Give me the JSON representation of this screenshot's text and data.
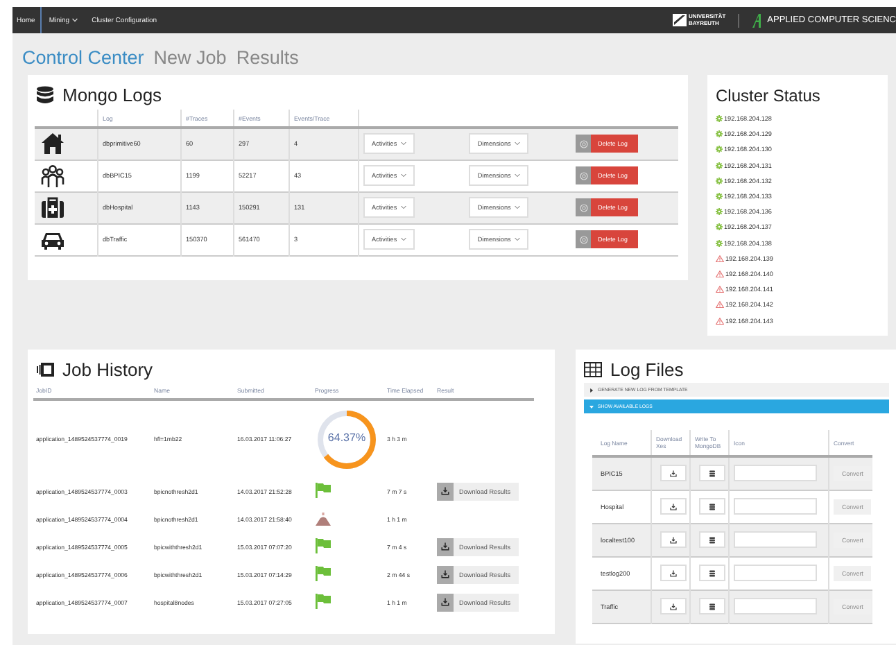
{
  "nav": {
    "items": [
      {
        "label": "Home",
        "dropdown": false
      },
      {
        "label": "Mining",
        "dropdown": true
      },
      {
        "label": "Cluster Configuration",
        "dropdown": false
      }
    ],
    "university_logo": {
      "line_1": "UNIVERSITÄT",
      "line_2": "BAYREUTH"
    },
    "department_logo": "APPLIED COMPUTER SCIENC"
  },
  "tabs": [
    {
      "label": "Control Center",
      "selected": true
    },
    {
      "label": "New Job",
      "selected": false
    },
    {
      "label": "Results",
      "selected": false
    }
  ],
  "mongo_logs": {
    "title": "Mongo Logs",
    "columns": [
      "Log",
      "#Traces",
      "#Events",
      "Events/Trace"
    ],
    "rows": [
      {
        "log": "dbprimitive60",
        "traces": "60",
        "events": "297",
        "events_per_trace": "4",
        "activities": "Activities",
        "dimensions": "Dimensions",
        "delete": "Delete Log"
      },
      {
        "log": "dbBPIC15",
        "traces": "1199",
        "events": "52217",
        "events_per_trace": "43",
        "activities": "Activities",
        "dimensions": "Dimensions",
        "delete": "Delete Log"
      },
      {
        "log": "dbHospital",
        "traces": "1143",
        "events": "150291",
        "events_per_trace": "131",
        "activities": "Activities",
        "dimensions": "Dimensions",
        "delete": "Delete Log"
      },
      {
        "log": "dbTraffic",
        "traces": "150370",
        "events": "561470",
        "events_per_trace": "3",
        "activities": "Activities",
        "dimensions": "Dimensions",
        "delete": "Delete Log"
      }
    ]
  },
  "cluster_status": {
    "title": "Cluster Status",
    "nodes": [
      {
        "ip": "192.168.204.128",
        "kind": "ok"
      },
      {
        "ip": "192.168.204.129",
        "kind": "ok"
      },
      {
        "ip": "192.168.204.130",
        "kind": "ok"
      },
      {
        "ip": "192.168.204.131",
        "kind": "ok"
      },
      {
        "ip": "192.168.204.132",
        "kind": "ok"
      },
      {
        "ip": "192.168.204.133",
        "kind": "ok"
      },
      {
        "ip": "192.168.204.136",
        "kind": "ok"
      },
      {
        "ip": "192.168.204.137",
        "kind": "ok"
      },
      {
        "ip": "192.168.204.138",
        "kind": "ok"
      },
      {
        "ip": "192.168.204.139",
        "kind": "warning"
      },
      {
        "ip": "192.168.204.140",
        "kind": "warning"
      },
      {
        "ip": "192.168.204.141",
        "kind": "warning"
      },
      {
        "ip": "192.168.204.142",
        "kind": "warning"
      },
      {
        "ip": "192.168.204.143",
        "kind": "warning"
      }
    ]
  },
  "job_history": {
    "title": "Job History",
    "columns": [
      "JobID",
      "Name",
      "Submitted",
      "Progress",
      "Time Elapsed",
      "Result"
    ],
    "rows": [
      {
        "job_id": "application_1489524537774_0019",
        "name": "hfl=1mb22",
        "submitted": "16.03.2017 11:06:27",
        "kind": "running",
        "level": 0.6437,
        "progress": "64.37%",
        "elapsed": "3 h 3 m"
      },
      {
        "job_id": "application_1489524537774_0003",
        "name": "bpicnothresh2d1",
        "submitted": "14.03.2017 21:52:28",
        "kind": "finished",
        "elapsed": "7 m 7 s",
        "result": "Download Results"
      },
      {
        "job_id": "application_1489524537774_0004",
        "name": "bpicnothresh2d1",
        "submitted": "14.03.2017 21:58:40",
        "kind": "failed",
        "elapsed": "1 h 1 m"
      },
      {
        "job_id": "application_1489524537774_0005",
        "name": "bpicwiththresh2d1",
        "submitted": "15.03.2017 07:07:20",
        "kind": "finished",
        "elapsed": "7 m 4 s",
        "result": "Download Results"
      },
      {
        "job_id": "application_1489524537774_0006",
        "name": "bpicwiththresh2d1",
        "submitted": "15.03.2017 07:14:29",
        "kind": "finished",
        "elapsed": "2 m 44 s",
        "result": "Download Results"
      },
      {
        "job_id": "application_1489524537774_0007",
        "name": "hospital8nodes",
        "submitted": "15.03.2017 07:27:05",
        "kind": "finished",
        "elapsed": "1 h 1 m",
        "result": "Download Results"
      }
    ]
  },
  "log_files": {
    "title": "Log Files",
    "sections": [
      {
        "label": "GENERATE NEW LOG FROM TEMPLATE",
        "expanded": false
      },
      {
        "label": "SHOW AVAILABLE LOGS",
        "expanded": true
      }
    ],
    "columns": [
      "Log Name",
      "Download Xes",
      "Write To MongoDB",
      "Icon",
      "Convert"
    ],
    "rows": [
      {
        "name": "BPIC15",
        "convert": "Convert",
        "disabled": true
      },
      {
        "name": "Hospital",
        "convert": "Convert",
        "disabled": true
      },
      {
        "name": "localtest100",
        "convert": "Convert",
        "disabled": true
      },
      {
        "name": "testlog200",
        "convert": "Convert",
        "disabled": true
      },
      {
        "name": "Traffic",
        "convert": "Convert",
        "disabled": true
      }
    ]
  }
}
